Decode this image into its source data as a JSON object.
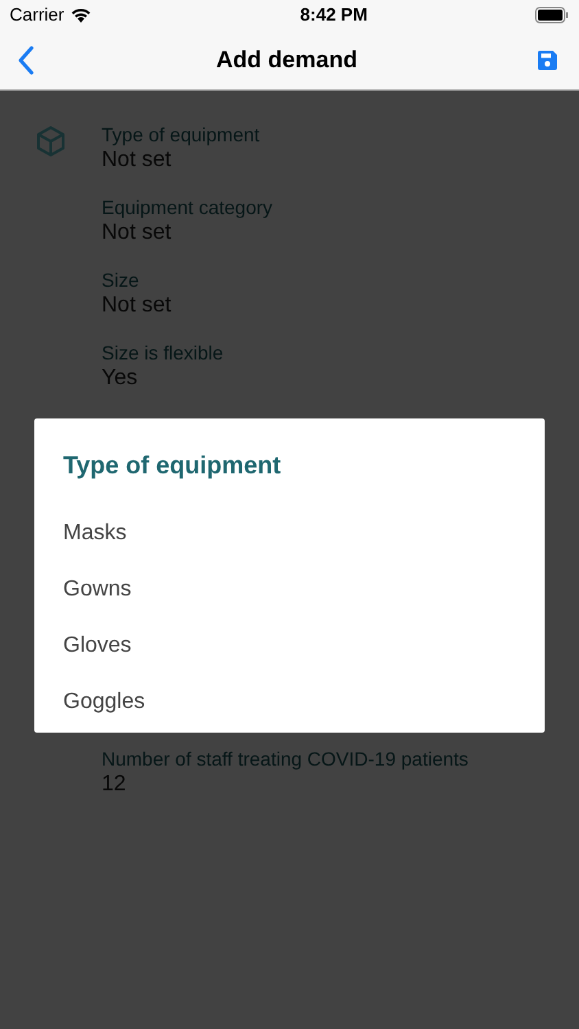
{
  "status_bar": {
    "carrier": "Carrier",
    "time": "8:42 PM"
  },
  "nav_bar": {
    "title": "Add demand"
  },
  "fields": [
    {
      "label": "Type of equipment",
      "value": "Not set",
      "icon": true
    },
    {
      "label": "Equipment category",
      "value": "Not set",
      "icon": false
    },
    {
      "label": "Size",
      "value": "Not set",
      "icon": false
    },
    {
      "label": "Size is flexible",
      "value": "Yes",
      "icon": false
    }
  ],
  "dialog": {
    "title": "Type of equipment",
    "options": [
      "Masks",
      "Gowns",
      "Gloves",
      "Goggles"
    ]
  },
  "fields_below": [
    {
      "label": "Number of staff treating COVID-19 patients",
      "value": "12"
    }
  ]
}
